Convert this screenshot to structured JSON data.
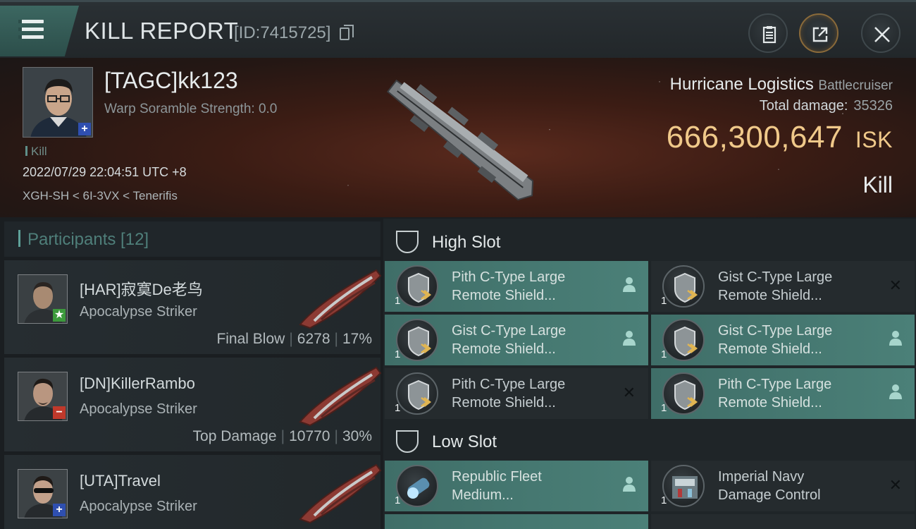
{
  "header": {
    "title": "KILL REPORT",
    "report_id": "[ID:7415725]",
    "copy_icon": "copy-icon",
    "clipboard_icon": "clipboard-icon",
    "share_icon": "share-icon",
    "close_icon": "close-icon",
    "menu_icon": "hamburger-menu-icon"
  },
  "victim": {
    "name": "[TAGC]kk123",
    "warp_scramble": "Warp Soramble Strength: 0.0",
    "kill_tag": "Kill",
    "datetime": "2022/07/29 22:04:51 UTC +8",
    "location": "XGH-SH < 6I-3VX < Tenerifis",
    "badge": "+",
    "ship_name": "Hurricane Logistics",
    "ship_class": "Battlecruiser",
    "total_damage_label": "Total damage:",
    "total_damage": "35326",
    "isk_value": "666,300,647",
    "isk_unit": "ISK",
    "result": "Kill"
  },
  "participants": {
    "header": "Participants [12]",
    "rows": [
      {
        "name": "[HAR]寂寞De老鸟",
        "ship": "Apocalypse Striker",
        "role": "Final Blow",
        "damage": "6278",
        "percent": "17%",
        "badge": "★",
        "badge_color": "#3c9a3c"
      },
      {
        "name": "[DN]KillerRambo",
        "ship": "Apocalypse Striker",
        "role": "Top Damage",
        "damage": "10770",
        "percent": "30%",
        "badge": "−",
        "badge_color": "#c0392b"
      },
      {
        "name": "[UTA]Travel",
        "ship": "Apocalypse Striker",
        "role": "",
        "damage": "",
        "percent": "",
        "badge": "+",
        "badge_color": "#2f4fb0"
      }
    ]
  },
  "slots": {
    "high": {
      "label": "High Slot",
      "modules": [
        {
          "line1": "Pith C-Type Large",
          "line2": "Remote Shield...",
          "qty": "1",
          "state": "on",
          "status_icon": "person-icon"
        },
        {
          "line1": "Gist C-Type Large",
          "line2": "Remote Shield...",
          "qty": "1",
          "state": "off",
          "status_icon": "x-icon"
        },
        {
          "line1": "Gist C-Type Large",
          "line2": "Remote Shield...",
          "qty": "1",
          "state": "on",
          "status_icon": "person-icon"
        },
        {
          "line1": "Gist C-Type Large",
          "line2": "Remote Shield...",
          "qty": "1",
          "state": "on",
          "status_icon": "person-icon"
        },
        {
          "line1": "Pith C-Type Large",
          "line2": "Remote Shield...",
          "qty": "1",
          "state": "off",
          "status_icon": "x-icon"
        },
        {
          "line1": "Pith C-Type Large",
          "line2": "Remote Shield...",
          "qty": "1",
          "state": "on",
          "status_icon": "person-icon"
        }
      ]
    },
    "low": {
      "label": "Low Slot",
      "modules": [
        {
          "line1": "Republic Fleet",
          "line2": "Medium...",
          "qty": "1",
          "state": "on",
          "status_icon": "person-icon"
        },
        {
          "line1": "Imperial Navy",
          "line2": "Damage Control",
          "qty": "1",
          "state": "off",
          "status_icon": "x-icon"
        }
      ]
    }
  },
  "colors": {
    "accent_teal": "#4b8078",
    "isk_gold": "#f0c98a",
    "background": "#1a1e21"
  }
}
